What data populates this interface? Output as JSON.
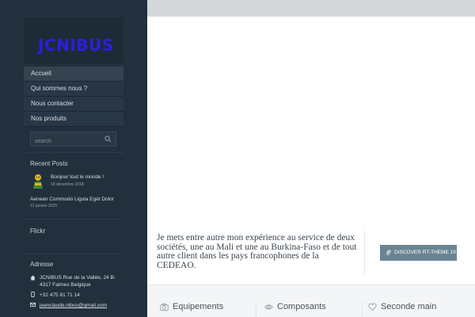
{
  "site": {
    "logo": "JCNIBUS"
  },
  "nav": {
    "items": [
      {
        "label": "Accueil"
      },
      {
        "label": "Qui sommes nous ?"
      },
      {
        "label": "Nous contacter"
      },
      {
        "label": "Nos produits"
      }
    ]
  },
  "search": {
    "placeholder": "search"
  },
  "recent_posts": {
    "title": "Recent Posts",
    "posts": [
      {
        "title": "Bonjour tout le monde !",
        "date": "19 décembre 2018"
      },
      {
        "title": "Aenean Commodo Ligula Eget Dolor",
        "date": "12 janvier 2015"
      }
    ]
  },
  "flickr": {
    "title": "Flickr"
  },
  "address": {
    "title": "Adresse",
    "street": "JCNIBUS Rue de la Vallée, 24 B-4317 Faimes Belgique",
    "phone": "+32 475 81 71 14",
    "email": "jeanclaude.nibus@gmail.com"
  },
  "promo": {
    "text": "Je mets entre autre mon expérience au service de deux sociétés, une au Mali et une au Burkina-Faso et de tout autre client dans les pays francophones de la CEDEAO.",
    "button_label": "DISCOVER RT-THEME 19"
  },
  "features": [
    {
      "label": "Equipements",
      "icon": "camera-icon"
    },
    {
      "label": "Composants",
      "icon": "eye-icon"
    },
    {
      "label": "Seconde main",
      "icon": "heart-icon"
    }
  ],
  "colors": {
    "sidebar": "#22303d",
    "logo": "#2a1fe0",
    "button": "#6a8494"
  }
}
